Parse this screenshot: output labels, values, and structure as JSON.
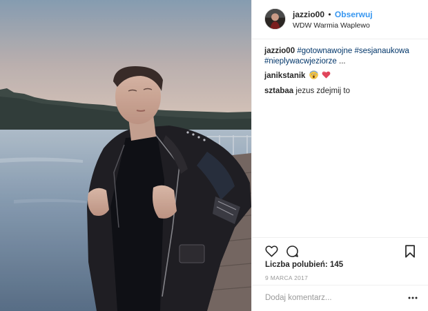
{
  "header": {
    "username": "jazzio00",
    "separator": "•",
    "follow_label": "Obserwuj",
    "location": "WDW Warmia Waplewo"
  },
  "caption": {
    "username": "jazzio00",
    "hashtags": [
      "#gotownawojne",
      "#sesjanaukowa",
      "#nieplywacwjeziorze"
    ],
    "ellipsis": "..."
  },
  "comments": [
    {
      "username": "janikstanik",
      "text": "",
      "emojis": [
        "scream-face-emoji",
        "red-heart-emoji"
      ]
    },
    {
      "username": "sztabaa",
      "text": "jezus zdejmij to"
    }
  ],
  "actions": {
    "like_icon": "heart-outline-icon",
    "comment_icon": "comment-bubble-icon",
    "save_icon": "bookmark-icon",
    "more_icon": "more-options-icon"
  },
  "likes": {
    "label": "Liczba polubień:",
    "count": "145"
  },
  "date": "9 MARCA 2017",
  "add_comment": {
    "placeholder": "Dodaj komentarz..."
  },
  "colors": {
    "link_blue": "#3897f0",
    "hashtag": "#003569",
    "divider": "#efefef",
    "muted": "#999999"
  }
}
